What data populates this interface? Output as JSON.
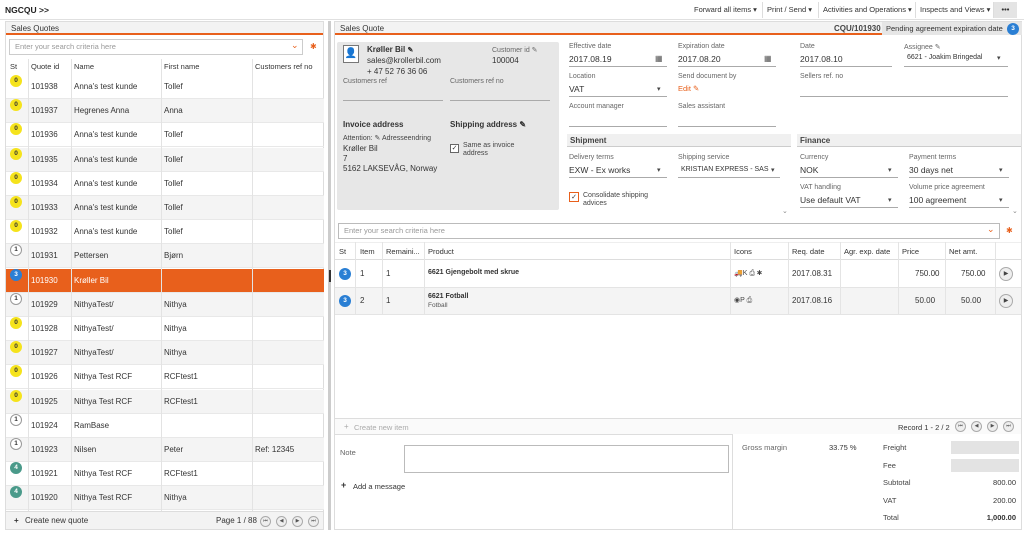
{
  "app": {
    "name": "NGCQU >>"
  },
  "topmenu": [
    "Forward all items ▾",
    "Print / Send ▾",
    "Activities and Operations ▾",
    "Inspects and Views ▾",
    "•••"
  ],
  "left": {
    "title": "Sales Quotes",
    "search_placeholder": "Enter your search criteria here",
    "columns": [
      "St",
      "Quote id",
      "Name",
      "First name",
      "Customers ref no"
    ],
    "rows": [
      {
        "st": "0",
        "id": "101938",
        "name": "Anna's test kunde",
        "first": "Tollef",
        "ref": ""
      },
      {
        "st": "0",
        "id": "101937",
        "name": "Hegrenes Anna",
        "first": "Anna",
        "ref": ""
      },
      {
        "st": "0",
        "id": "101936",
        "name": "Anna's test kunde",
        "first": "Tollef",
        "ref": ""
      },
      {
        "st": "0",
        "id": "101935",
        "name": "Anna's test kunde",
        "first": "Tollef",
        "ref": ""
      },
      {
        "st": "0",
        "id": "101934",
        "name": "Anna's test kunde",
        "first": "Tollef",
        "ref": ""
      },
      {
        "st": "0",
        "id": "101933",
        "name": "Anna's test kunde",
        "first": "Tollef",
        "ref": ""
      },
      {
        "st": "0",
        "id": "101932",
        "name": "Anna's test kunde",
        "first": "Tollef",
        "ref": ""
      },
      {
        "st": "1",
        "id": "101931",
        "name": "Pettersen",
        "first": "Bjørn",
        "ref": ""
      },
      {
        "st": "3",
        "id": "101930",
        "name": "Krøller Bil",
        "first": "",
        "ref": ""
      },
      {
        "st": "1",
        "id": "101929",
        "name": "NithyaTest/",
        "first": "Nithya",
        "ref": ""
      },
      {
        "st": "0",
        "id": "101928",
        "name": "NithyaTest/",
        "first": "Nithya",
        "ref": ""
      },
      {
        "st": "0",
        "id": "101927",
        "name": "NithyaTest/",
        "first": "Nithya",
        "ref": ""
      },
      {
        "st": "0",
        "id": "101926",
        "name": "Nithya Test RCF",
        "first": "RCFtest1",
        "ref": ""
      },
      {
        "st": "0",
        "id": "101925",
        "name": "Nithya Test RCF",
        "first": "RCFtest1",
        "ref": ""
      },
      {
        "st": "1",
        "id": "101924",
        "name": "RamBase",
        "first": "",
        "ref": ""
      },
      {
        "st": "1",
        "id": "101923",
        "name": "Nilsen",
        "first": "Peter",
        "ref": "Ref: 12345"
      },
      {
        "st": "4",
        "id": "101921",
        "name": "Nithya Test RCF",
        "first": "RCFtest1",
        "ref": ""
      },
      {
        "st": "4",
        "id": "101920",
        "name": "Nithya Test RCF",
        "first": "Nithya",
        "ref": ""
      }
    ],
    "selected_id": "101930",
    "create_label": "Create new quote",
    "page_label": "Page 1 / 88"
  },
  "right": {
    "title": "Sales Quote",
    "quote_ref": "CQU/101930",
    "status_text": "Pending agreement expiration date",
    "status_badge": "3",
    "customer": {
      "name": "Krøller Bil",
      "email": "sales@krollerbil.com",
      "phone": "+ 47 52 76 36 06",
      "cust_id_label": "Customer id",
      "cust_id": "100004",
      "cust_ref_label": "Customers ref",
      "cust_ref_no_label": "Customers ref no",
      "invoice_label": "Invoice address",
      "attention": "Attention:",
      "change_label": "Adresseendring",
      "addr1": "Krøller Bil",
      "addr2": "7",
      "addr3": "5162 LAKSEVÅG, Norway",
      "shipping_label": "Shipping address",
      "same_as": "Same as invoice address"
    },
    "fields": {
      "effective_label": "Effective date",
      "effective": "2017.08.19",
      "expiration_label": "Expiration date",
      "expiration": "2017.08.20",
      "date_label": "Date",
      "date": "2017.08.10",
      "assignee_label": "Assignee",
      "assignee": "6621 - Joakim Bringedal",
      "location_label": "Location",
      "location": "VAT",
      "send_doc_label": "Send document by",
      "send_doc": "Edit",
      "sellers_ref_label": "Sellers ref. no",
      "account_mgr_label": "Account manager",
      "sales_asst_label": "Sales assistant"
    },
    "shipment": {
      "title": "Shipment",
      "delivery_terms_label": "Delivery terms",
      "delivery_terms": "EXW - Ex works",
      "shipping_service_label": "Shipping service",
      "shipping_service": "KRISTIAN EXPRESS - SAS",
      "consolidate": "Consolidate shipping advices"
    },
    "finance": {
      "title": "Finance",
      "currency_label": "Currency",
      "currency": "NOK",
      "payment_terms_label": "Payment terms",
      "payment_terms": "30 days net",
      "vat_label": "VAT handling",
      "vat": "Use default VAT",
      "volume_label": "Volume price agreement",
      "volume": "100 agreement"
    },
    "items_search_placeholder": "Enter your search criteria here",
    "item_columns": [
      "St",
      "Item",
      "Remaini...",
      "Product",
      "Icons",
      "Req. date",
      "Agr. exp. date",
      "Price",
      "Net amt."
    ],
    "items": [
      {
        "st": "3",
        "item": "1",
        "remaining": "1",
        "product": "6621 Gjengebolt med skrue",
        "sub": "",
        "icons": "🚚K  ⎙  ✱",
        "req": "2017.08.31",
        "agr": "",
        "price": "750.00",
        "net": "750.00"
      },
      {
        "st": "3",
        "item": "2",
        "remaining": "1",
        "product": "6621 Fotball",
        "sub": "Fotball",
        "icons": "◉P  ⎙",
        "req": "2017.08.16",
        "agr": "",
        "price": "50.00",
        "net": "50.00"
      }
    ],
    "create_item_label": "Create new item",
    "record_label": "Record 1 - 2 / 2",
    "note_label": "Note",
    "add_message": "Add a message",
    "gross_margin_label": "Gross margin",
    "gross_margin": "33.75 %",
    "totals": [
      {
        "label": "Freight",
        "value": ""
      },
      {
        "label": "Fee",
        "value": ""
      },
      {
        "label": "Subtotal",
        "value": "800.00"
      },
      {
        "label": "VAT",
        "value": "200.00"
      },
      {
        "label": "Total",
        "value": "1,000.00"
      }
    ]
  }
}
